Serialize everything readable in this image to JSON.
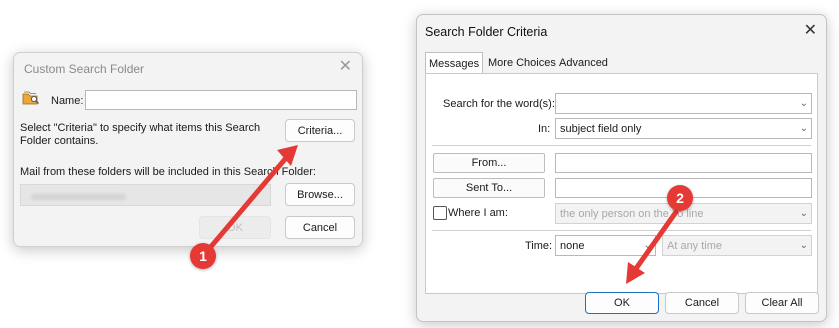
{
  "left_dialog": {
    "title": "Custom Search Folder",
    "close_glyph": "✕",
    "name_label": "Name:",
    "name_value": "",
    "criteria_text_1": "Select \"Criteria\" to specify what items this Search",
    "criteria_text_2": "Folder contains.",
    "criteria_button": "Criteria...",
    "mail_from_text": "Mail from these folders will be included in this Search Folder:",
    "browse_button": "Browse...",
    "ok_button": "OK",
    "cancel_button": "Cancel",
    "folder_icon": "folder-search-icon"
  },
  "right_dialog": {
    "title": "Search Folder Criteria",
    "close_glyph": "✕",
    "tabs": [
      {
        "label": "Messages",
        "active": true
      },
      {
        "label": "More Choices",
        "active": false
      },
      {
        "label": "Advanced",
        "active": false
      }
    ],
    "search_words_label": "Search for the word(s):",
    "search_words_value": "",
    "in_label": "In:",
    "in_value": "subject field only",
    "from_button": "From...",
    "from_value": "",
    "sent_to_button": "Sent To...",
    "sent_to_value": "",
    "where_i_am_label": "Where I am:",
    "where_i_am_checked": false,
    "where_i_am_value": "the only person on the To line",
    "time_label": "Time:",
    "time_value": "none",
    "time_range_value": "At any time",
    "ok_button": "OK",
    "cancel_button": "Cancel",
    "clear_all_button": "Clear All"
  },
  "annotations": {
    "step1": "1",
    "step2": "2",
    "color": "#e53935"
  }
}
